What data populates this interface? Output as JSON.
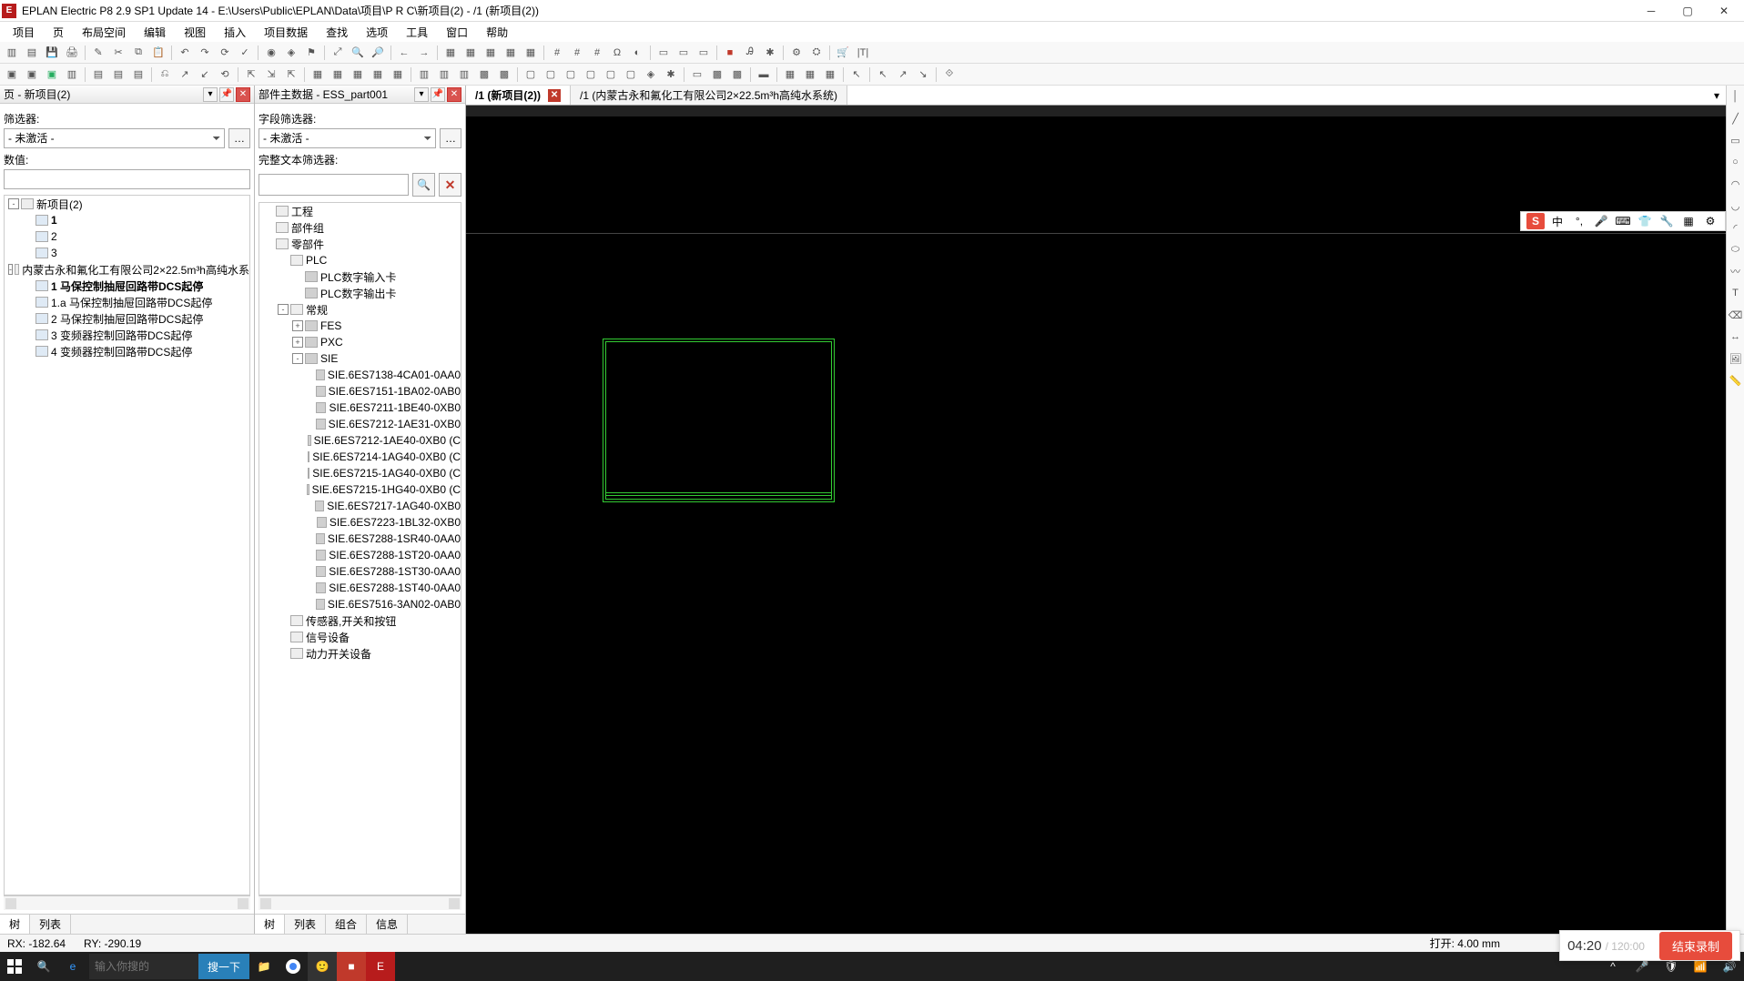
{
  "titlebar": {
    "title": "EPLAN Electric P8 2.9 SP1 Update 14 - E:\\Users\\Public\\EPLAN\\Data\\项目\\P R C\\新项目(2) - /1 (新项目(2))"
  },
  "menu": [
    "项目",
    "页",
    "布局空间",
    "编辑",
    "视图",
    "插入",
    "项目数据",
    "查找",
    "选项",
    "工具",
    "窗口",
    "帮助"
  ],
  "panel_left": {
    "title": "页 - 新项目(2)",
    "filter_label": "筛选器:",
    "filter_value": "- 未激活 -",
    "value_label": "数值:",
    "tree": [
      {
        "t": "新项目(2)",
        "lvl": 0,
        "box": "-",
        "icon": "proj"
      },
      {
        "t": "1",
        "lvl": 1,
        "box": "",
        "icon": "page",
        "bold": true
      },
      {
        "t": "2",
        "lvl": 1,
        "box": "",
        "icon": "page"
      },
      {
        "t": "3",
        "lvl": 1,
        "box": "",
        "icon": "page"
      },
      {
        "t": "内蒙古永和氟化工有限公司2×22.5m³h高纯水系",
        "lvl": 0,
        "box": "-",
        "icon": "proj"
      },
      {
        "t": "1 马保控制抽屉回路带DCS起停",
        "lvl": 1,
        "box": "",
        "icon": "page",
        "bold": true
      },
      {
        "t": "1.a 马保控制抽屉回路带DCS起停",
        "lvl": 1,
        "box": "",
        "icon": "page"
      },
      {
        "t": "2 马保控制抽屉回路带DCS起停",
        "lvl": 1,
        "box": "",
        "icon": "page"
      },
      {
        "t": "3 变频器控制回路带DCS起停",
        "lvl": 1,
        "box": "",
        "icon": "page"
      },
      {
        "t": "4 变频器控制回路带DCS起停",
        "lvl": 1,
        "box": "",
        "icon": "page"
      }
    ],
    "tabs": [
      "树",
      "列表"
    ]
  },
  "panel_mid": {
    "title": "部件主数据 - ESS_part001",
    "field_filter_label": "字段筛选器:",
    "filter_value": "- 未激活 -",
    "fulltext_label": "完整文本筛选器:",
    "tree": [
      {
        "t": "工程",
        "lvl": 0,
        "box": "",
        "icon": "folder"
      },
      {
        "t": "部件组",
        "lvl": 0,
        "box": "",
        "icon": "folder"
      },
      {
        "t": "零部件",
        "lvl": 0,
        "box": "",
        "icon": "folder"
      },
      {
        "t": "PLC",
        "lvl": 1,
        "box": "",
        "icon": "folder"
      },
      {
        "t": "PLC数字输入卡",
        "lvl": 2,
        "box": "",
        "icon": "part"
      },
      {
        "t": "PLC数字输出卡",
        "lvl": 2,
        "box": "",
        "icon": "part"
      },
      {
        "t": "常规",
        "lvl": 1,
        "box": "-",
        "icon": "folder"
      },
      {
        "t": "FES",
        "lvl": 2,
        "box": "+",
        "icon": "part"
      },
      {
        "t": "PXC",
        "lvl": 2,
        "box": "+",
        "icon": "part"
      },
      {
        "t": "SIE",
        "lvl": 2,
        "box": "-",
        "icon": "part"
      },
      {
        "t": "SIE.6ES7138-4CA01-0AA0",
        "lvl": 3,
        "box": "",
        "icon": "part"
      },
      {
        "t": "SIE.6ES7151-1BA02-0AB0",
        "lvl": 3,
        "box": "",
        "icon": "part"
      },
      {
        "t": "SIE.6ES7211-1BE40-0XB0",
        "lvl": 3,
        "box": "",
        "icon": "part"
      },
      {
        "t": "SIE.6ES7212-1AE31-0XB0",
        "lvl": 3,
        "box": "",
        "icon": "part"
      },
      {
        "t": "SIE.6ES7212-1AE40-0XB0 (C",
        "lvl": 3,
        "box": "",
        "icon": "part"
      },
      {
        "t": "SIE.6ES7214-1AG40-0XB0 (C",
        "lvl": 3,
        "box": "",
        "icon": "part"
      },
      {
        "t": "SIE.6ES7215-1AG40-0XB0 (C",
        "lvl": 3,
        "box": "",
        "icon": "part"
      },
      {
        "t": "SIE.6ES7215-1HG40-0XB0 (C",
        "lvl": 3,
        "box": "",
        "icon": "part"
      },
      {
        "t": "SIE.6ES7217-1AG40-0XB0",
        "lvl": 3,
        "box": "",
        "icon": "part"
      },
      {
        "t": "SIE.6ES7223-1BL32-0XB0",
        "lvl": 3,
        "box": "",
        "icon": "part"
      },
      {
        "t": "SIE.6ES7288-1SR40-0AA0",
        "lvl": 3,
        "box": "",
        "icon": "part"
      },
      {
        "t": "SIE.6ES7288-1ST20-0AA0",
        "lvl": 3,
        "box": "",
        "icon": "part"
      },
      {
        "t": "SIE.6ES7288-1ST30-0AA0",
        "lvl": 3,
        "box": "",
        "icon": "part"
      },
      {
        "t": "SIE.6ES7288-1ST40-0AA0",
        "lvl": 3,
        "box": "",
        "icon": "part"
      },
      {
        "t": "SIE.6ES7516-3AN02-0AB0",
        "lvl": 3,
        "box": "",
        "icon": "part"
      },
      {
        "t": "传感器,开关和按钮",
        "lvl": 1,
        "box": "",
        "icon": "folder"
      },
      {
        "t": "信号设备",
        "lvl": 1,
        "box": "",
        "icon": "folder"
      },
      {
        "t": "动力开关设备",
        "lvl": 1,
        "box": "",
        "icon": "folder"
      }
    ],
    "tabs": [
      "树",
      "列表",
      "组合",
      "信息"
    ]
  },
  "editor": {
    "tabs": [
      {
        "label": "/1 (新项目(2))",
        "active": true,
        "closeable": true
      },
      {
        "label": "/1 (内蒙古永和氟化工有限公司2×22.5m³h高纯水系统)",
        "active": false,
        "closeable": false
      }
    ]
  },
  "ime": {
    "lang": "中"
  },
  "status": {
    "rx": "RX: -182.64",
    "ry": "RY: -290.19",
    "open": "打开: 4.00 mm"
  },
  "recording": {
    "current": "04:20",
    "sep": " / ",
    "total": "120:00",
    "stop": "结束录制"
  },
  "taskbar": {
    "search_placeholder": "输入你搜的",
    "search_btn": "搜一下"
  }
}
